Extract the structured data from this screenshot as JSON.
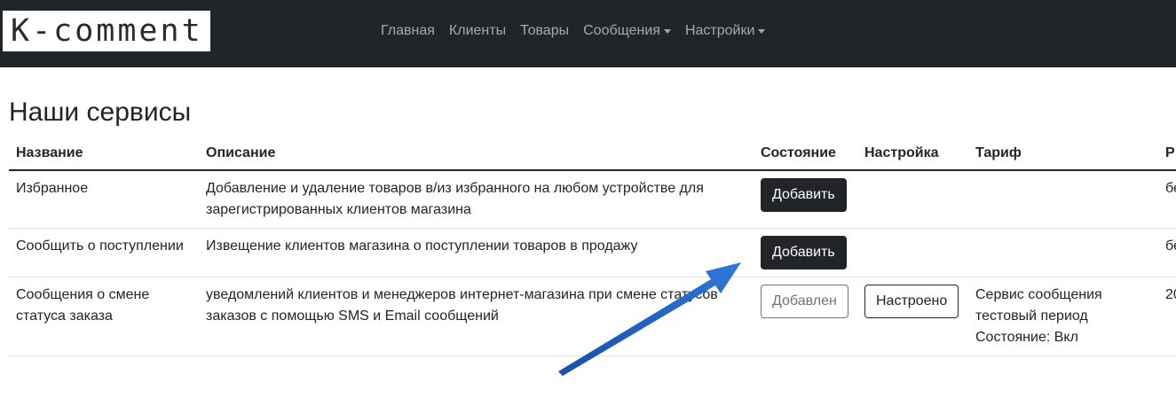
{
  "brand": {
    "logo_text": "K-comment"
  },
  "nav": {
    "items": [
      {
        "label": "Главная",
        "dropdown": false
      },
      {
        "label": "Клиенты",
        "dropdown": false
      },
      {
        "label": "Товары",
        "dropdown": false
      },
      {
        "label": "Сообщения",
        "dropdown": true
      },
      {
        "label": "Настройки",
        "dropdown": true
      }
    ]
  },
  "page": {
    "title": "Наши сервисы"
  },
  "table": {
    "headers": [
      "Название",
      "Описание",
      "Состояние",
      "Настройка",
      "Тариф",
      "Р"
    ],
    "rows": [
      {
        "name": "Избранное",
        "description": "Добавление и удаление товаров в/из избранного на любом устройстве для зарегистрированных клиентов магазина",
        "status_button": "Добавить",
        "settings_button": "",
        "tariff_lines": [],
        "last": "бе"
      },
      {
        "name": "Сообщить о поступлении",
        "description": "Извещение клиентов магазина о поступлении товаров в продажу",
        "status_button": "Добавить",
        "settings_button": "",
        "tariff_lines": [],
        "last": "бе"
      },
      {
        "name": "Сообщения о смене статуса заказа",
        "description": "уведомлений клиентов и менеджеров интернет-магазина при смене статусов заказов с помощью SMS и Email сообщений",
        "status_button": "Добавлен",
        "settings_button": "Настроено",
        "tariff_lines": [
          "Сервис сообщения",
          "тестовый период",
          "Состояние: Вкл"
        ],
        "last": "20"
      }
    ]
  },
  "colors": {
    "navbar_bg": "#212529",
    "arrow": "#1f5fbf"
  }
}
